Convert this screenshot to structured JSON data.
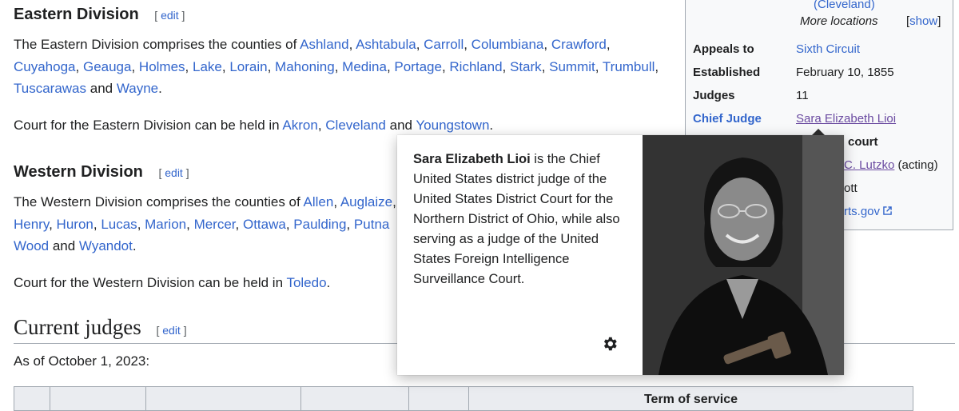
{
  "eastern": {
    "heading": "Eastern Division",
    "edit_label": "edit",
    "intro": "The Eastern Division comprises the counties of ",
    "counties": [
      "Ashland",
      "Ashtabula",
      "Carroll",
      "Columbiana",
      "Crawford",
      "Cuyahoga",
      "Geauga",
      "Holmes",
      "Lake",
      "Lorain",
      "Mahoning",
      "Medina",
      "Portage",
      "Richland",
      "Stark",
      "Summit",
      "Trumbull",
      "Tuscarawas",
      "Wayne"
    ],
    "and_word": "and",
    "court_text": "Court for the Eastern Division can be held in ",
    "cities": [
      "Akron",
      "Cleveland",
      "Youngstown"
    ]
  },
  "western": {
    "heading": "Western Division",
    "edit_label": "edit",
    "intro": "The Western Division comprises the counties of ",
    "counties_line1": [
      "Allen",
      "Auglaize"
    ],
    "counties_line2": [
      "Henry",
      "Huron",
      "Lucas",
      "Marion",
      "Mercer",
      "Ottawa",
      "Paulding",
      "Putna"
    ],
    "counties_line3": [
      "Wood",
      "Wyandot"
    ],
    "and_word": "and",
    "court_text": "Court for the Western Division can be held in ",
    "city": "Toledo"
  },
  "current_judges": {
    "heading": "Current judges",
    "edit_label": "edit",
    "as_of": "As of October 1, 2023:",
    "table_header": "Term of service"
  },
  "infobox": {
    "top_link": "(Cleveland)",
    "more_locations": "More locations",
    "show_label": "show",
    "rows": [
      {
        "label": "Appeals to",
        "value": "Sixth Circuit"
      },
      {
        "label": "Established",
        "value": "February 10, 1855"
      },
      {
        "label": "Judges",
        "value": "11"
      },
      {
        "label": "Chief Judge",
        "value": "Sara Elizabeth Lioi"
      }
    ],
    "partial_court": "court",
    "partial_lutzko": "C. Lutzko",
    "partial_acting": "(acting)",
    "partial_ott": "ott",
    "partial_site": "rts.gov"
  },
  "popup": {
    "name": "Sara Elizabeth Lioi",
    "text": " is the Chief United States district judge of the United States District Court for the Northern District of Ohio, while also serving as a judge of the United States Foreign Intelligence Surveillance Court."
  },
  "colors": {
    "link": "#3366cc",
    "visited": "#6b4ba1",
    "text": "#202122"
  }
}
